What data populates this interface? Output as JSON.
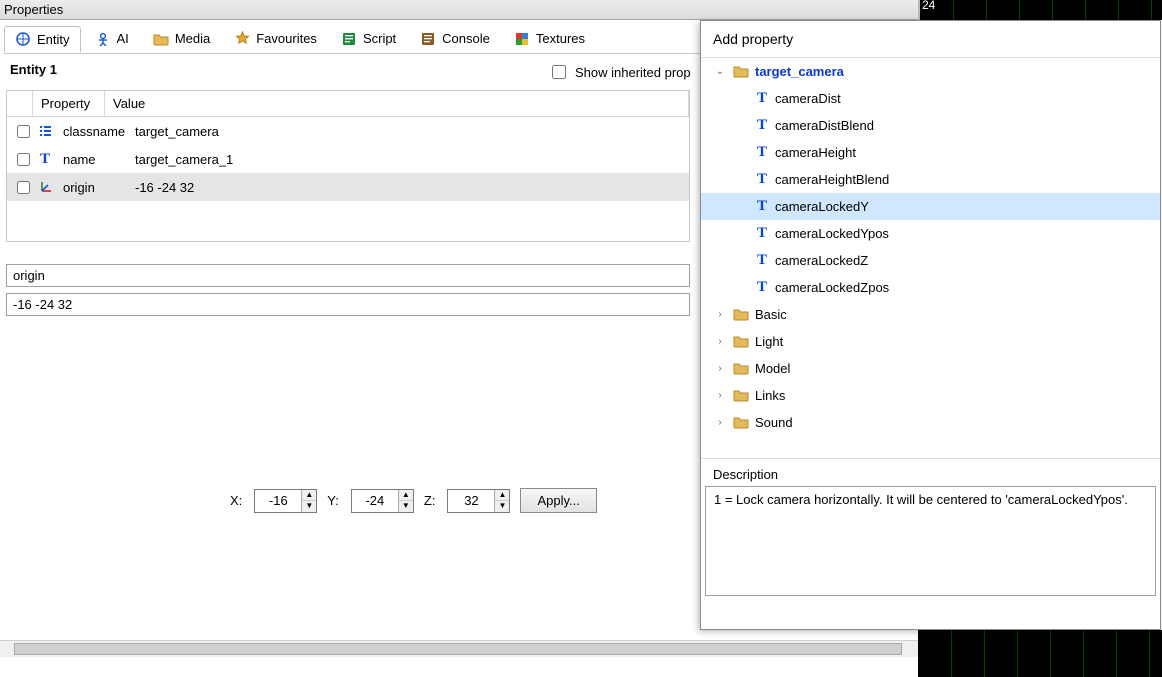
{
  "panel": {
    "title": "Properties"
  },
  "timeline": {
    "label": "24"
  },
  "tabs": {
    "entity": "Entity",
    "ai": "AI",
    "media": "Media",
    "favourites": "Favourites",
    "script": "Script",
    "console": "Console",
    "textures": "Textures"
  },
  "entity": {
    "name": "Entity 1"
  },
  "inherited": {
    "label": "Show inherited prop"
  },
  "table": {
    "headers": {
      "property": "Property",
      "value": "Value"
    },
    "rows": [
      {
        "name": "classname",
        "value": "target_camera",
        "icon": "list"
      },
      {
        "name": "name",
        "value": "target_camera_1",
        "icon": "text"
      },
      {
        "name": "origin",
        "value": "-16 -24 32",
        "icon": "axis"
      }
    ]
  },
  "editor": {
    "key": "origin",
    "value": "-16 -24 32"
  },
  "xyz": {
    "xlabel": "X:",
    "x": "-16",
    "ylabel": "Y:",
    "y": "-24",
    "zlabel": "Z:",
    "z": "32",
    "apply": "Apply..."
  },
  "addp": {
    "title": "Add property",
    "root": "target_camera",
    "props": [
      "cameraDist",
      "cameraDistBlend",
      "cameraHeight",
      "cameraHeightBlend",
      "cameraLockedY",
      "cameraLockedYpos",
      "cameraLockedZ",
      "cameraLockedZpos"
    ],
    "selected": "cameraLockedY",
    "groups": [
      "Basic",
      "Light",
      "Model",
      "Links",
      "Sound"
    ],
    "description_label": "Description",
    "description_text": "1 = Lock camera horizontally. It will be centered to 'cameraLockedYpos'."
  }
}
